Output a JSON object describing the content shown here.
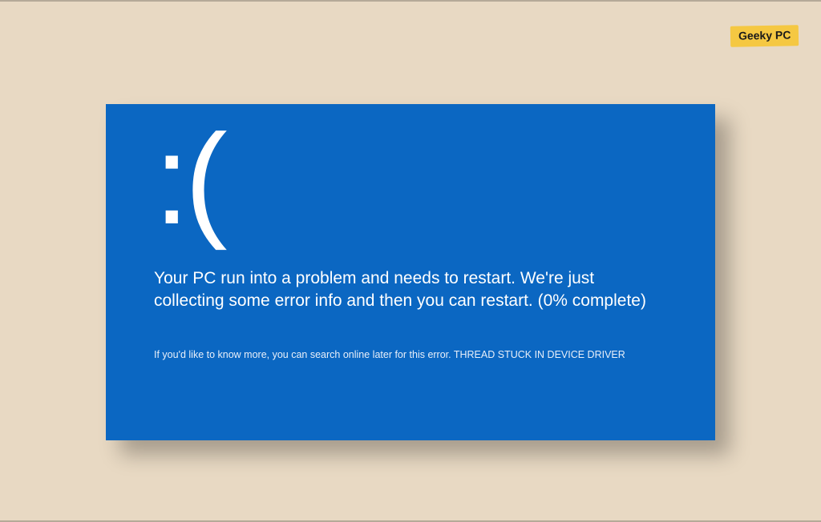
{
  "watermark": {
    "label": "Geeky PC"
  },
  "bsod": {
    "face": ":(",
    "message": "Your PC run into a problem and needs to restart. We're just collecting some error info and then you can restart. (0% complete)",
    "detail": "If you'd like to know more, you can search online later for this error. THREAD STUCK IN DEVICE DRIVER"
  }
}
